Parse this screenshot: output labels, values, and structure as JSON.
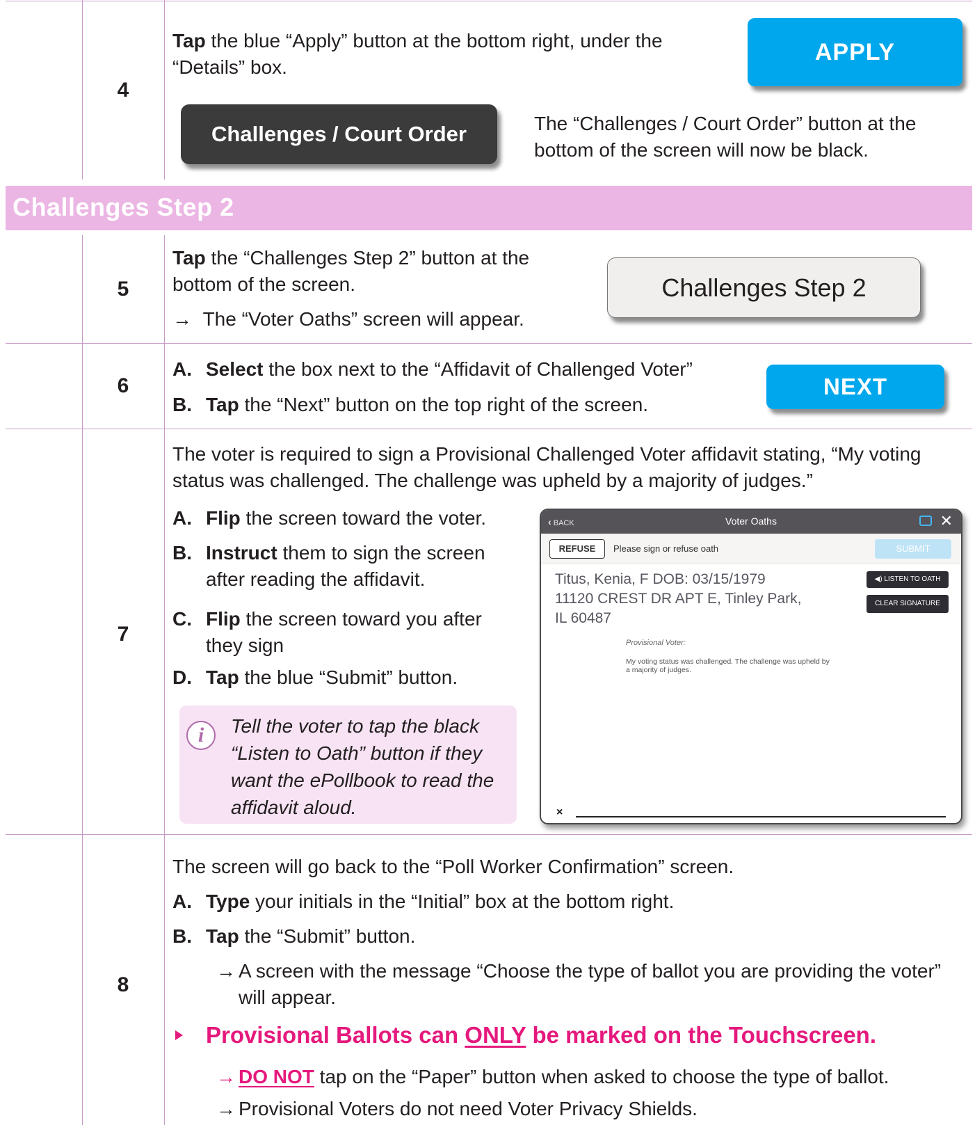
{
  "step4": {
    "number": "4",
    "tap": "Tap",
    "instruction_rest": " the blue “Apply” button at the bottom right, under the “Details” box.",
    "apply_button": "APPLY",
    "court_order_button": "Challenges / Court Order",
    "result_text": "The “Challenges / Court Order” button at the bottom of the screen will now be black."
  },
  "section": {
    "title": "Challenges Step 2"
  },
  "step5": {
    "number": "5",
    "tap": "Tap",
    "instruction_rest": " the “Challenges Step 2” button at the bottom of the screen.",
    "arrow": "→",
    "result_text": "The “Voter Oaths” screen will appear.",
    "button_label": "Challenges Step 2"
  },
  "step6": {
    "number": "6",
    "a_label": "A.",
    "a_verb": "Select",
    "a_rest": " the box next to the “Affidavit of Challenged Voter”",
    "b_label": "B.",
    "b_verb": "Tap",
    "b_rest": " the “Next” button on the top right of the screen.",
    "next_button": "NEXT"
  },
  "step7": {
    "number": "7",
    "intro": "The voter is required to sign a Provisional Challenged Voter affidavit stating, “My voting status was challenged. The challenge was upheld by a majority of judges.”",
    "a_label": "A.",
    "a_verb": "Flip",
    "a_rest": " the screen toward the voter.",
    "b_label": "B.",
    "b_verb": "Instruct",
    "b_rest": " them to sign the screen after reading the affidavit.",
    "c_label": "C.",
    "c_verb": "Flip",
    "c_rest": " the screen toward you after they sign",
    "d_label": "D.",
    "d_verb": "Tap",
    "d_rest": " the blue “Submit” button.",
    "note_icon": "i",
    "note": "Tell the voter to tap the black “Listen to Oath” button if they want the ePollbook to read the affidavit aloud.",
    "device": {
      "back": "BACK",
      "back_icon": "chevron-left-icon",
      "title": "Voter Oaths",
      "close": "✕",
      "refuse": "REFUSE",
      "prompt": "Please sign or refuse oath",
      "submit": "SUBMIT",
      "voter_line1": "Titus, Kenia, F DOB: 03/15/1979",
      "voter_line2": "11120 CREST DR APT E, Tinley Park,",
      "voter_line3": "IL 60487",
      "listen": "◀) LISTEN TO OATH",
      "clear": "CLEAR SIGNATURE",
      "prov_heading": "Provisional Voter:",
      "prov_text": "My voting status was challenged. The challenge was upheld by a majority of judges.",
      "sig_x": "×"
    }
  },
  "step8": {
    "number": "8",
    "intro": "The screen will go back to the “Poll Worker Confirmation” screen.",
    "a_label": "A.",
    "a_verb": "Type",
    "a_rest": " your initials in the “Initial” box at the bottom right.",
    "b_label": "B.",
    "b_verb": "Tap",
    "b_rest": " the “Submit” button.",
    "arrow": "→",
    "b_result": "A screen with the message “Choose the type of ballot you are providing the voter” will appear.",
    "warning_pre": "Provisional Ballots can ",
    "warning_emph": "ONLY",
    "warning_post": " be marked on the Touchscreen.",
    "sub1_emph": "DO NOT",
    "sub1_rest": " tap on the “Paper” button when asked to choose the type of ballot.",
    "sub2": "Provisional Voters do not need Voter Privacy Shields."
  },
  "colors": {
    "rule": "#c89ac6",
    "band": "#ebb5e4",
    "blue_button": "#00a7ec",
    "dark_button": "#3b3b3b",
    "warning": "#e5197d",
    "note_bg": "#f7e3f3"
  }
}
